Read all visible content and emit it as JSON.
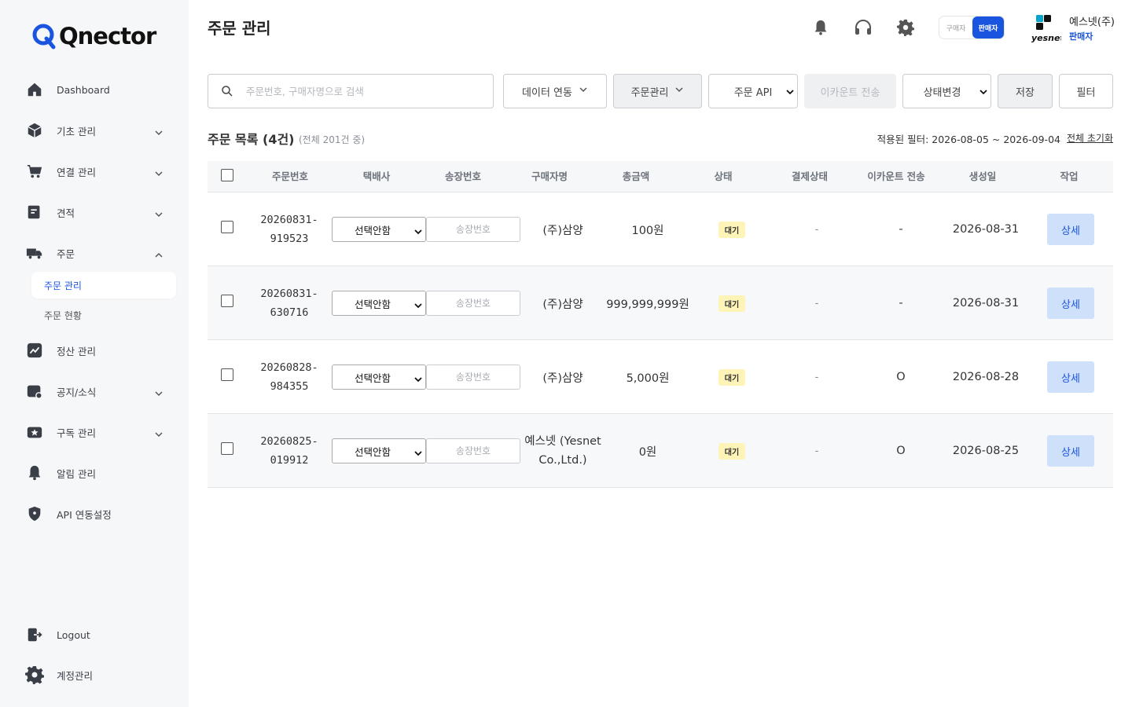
{
  "brand": {
    "name": "Qnector",
    "accent": "#1a55e0"
  },
  "sidebar": {
    "items": [
      {
        "label": "Dashboard",
        "icon": "home-icon"
      },
      {
        "label": "기초 관리",
        "icon": "box-icon"
      },
      {
        "label": "연결 관리",
        "icon": "cart-icon"
      },
      {
        "label": "견적",
        "icon": "quote-icon"
      },
      {
        "label": "주문",
        "icon": "truck-icon"
      },
      {
        "label": "정산 관리",
        "icon": "chart-icon"
      },
      {
        "label": "공지/소식",
        "icon": "notice-icon"
      },
      {
        "label": "구독 관리",
        "icon": "subscription-icon"
      },
      {
        "label": "알림 관리",
        "icon": "bell-icon"
      },
      {
        "label": "API 연동설정",
        "icon": "shield-icon"
      }
    ],
    "sub_items": [
      {
        "label": "주문 관리",
        "active": true
      },
      {
        "label": "주문 현황",
        "active": false
      }
    ],
    "bottom": [
      {
        "label": "Logout",
        "icon": "logout-icon"
      },
      {
        "label": "계정관리",
        "icon": "gear-icon"
      }
    ]
  },
  "header": {
    "title": "주문 관리",
    "role_buyer": "구매자",
    "role_seller": "판매자",
    "company_name": "예스넷(주)",
    "company_role": "판매자"
  },
  "toolbar": {
    "search_placeholder": "주문번호, 구매자명으로 검색",
    "data_link": "데이터 연동",
    "order_mgmt": "주문관리",
    "order_api": "주문 API",
    "ecount_send": "이카운트 전송",
    "status_change": "상태변경",
    "save": "저장",
    "filter": "필터"
  },
  "list": {
    "title": "주문 목록 (4건)",
    "subtitle": "(전체 201건 중)",
    "filter_label": "적용된 필터: 2026-08-05 ~ 2026-09-04",
    "reset": "전체 초기화"
  },
  "table": {
    "headers": [
      "주문번호",
      "택배사",
      "송장번호",
      "구매자명",
      "총금액",
      "상태",
      "결제상태",
      "이카운트 전송",
      "생성일",
      "작업"
    ],
    "courier_default": "선택안함",
    "tracking_placeholder": "송장번호",
    "detail_label": "상세",
    "rows": [
      {
        "order_no_1": "20260831-",
        "order_no_2": "919523",
        "buyer": "(주)삼양",
        "total": "100원",
        "status": "대기",
        "payment": "-",
        "ecount": "-",
        "created": "2026-08-31"
      },
      {
        "order_no_1": "20260831-",
        "order_no_2": "630716",
        "buyer": "(주)삼양",
        "total": "999,999,999원",
        "status": "대기",
        "payment": "-",
        "ecount": "-",
        "created": "2026-08-31"
      },
      {
        "order_no_1": "20260828-",
        "order_no_2": "984355",
        "buyer": "(주)삼양",
        "total": "5,000원",
        "status": "대기",
        "payment": "-",
        "ecount": "O",
        "created": "2026-08-28"
      },
      {
        "order_no_1": "20260825-",
        "order_no_2": "019912",
        "buyer": "예스넷 (Yesnet Co.,Ltd.)",
        "total": "0원",
        "status": "대기",
        "payment": "-",
        "ecount": "O",
        "created": "2026-08-25"
      }
    ]
  }
}
